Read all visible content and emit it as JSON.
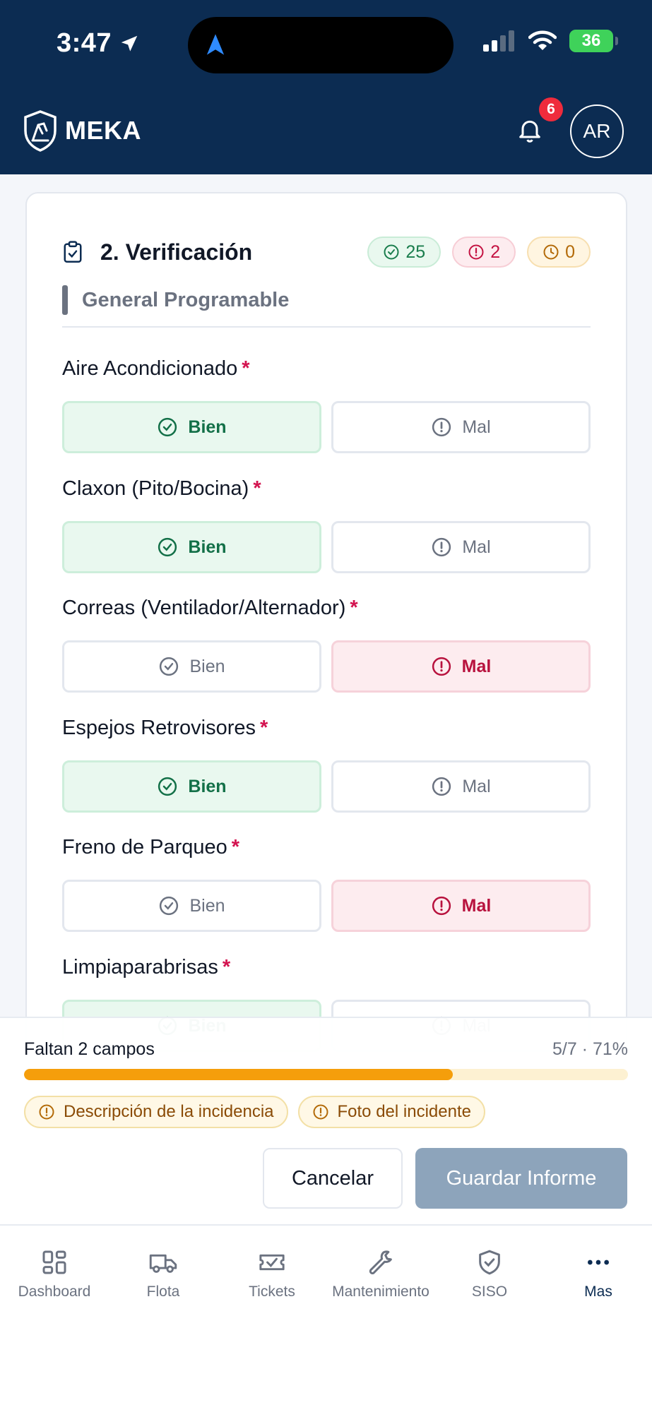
{
  "status_bar": {
    "time": "3:47",
    "battery": "36"
  },
  "header": {
    "brand": "MEKA",
    "notification_count": "6",
    "avatar_initials": "AR"
  },
  "card": {
    "title": "2. Verificación",
    "counters": {
      "ok": "25",
      "bad": "2",
      "pending": "0"
    },
    "section": "General Programable",
    "questions": [
      {
        "label": "Aire Acondicionado",
        "required": "*",
        "selected": "Bien"
      },
      {
        "label": "Claxon (Pito/Bocina)",
        "required": "*",
        "selected": "Bien"
      },
      {
        "label": "Correas (Ventilador/Alternador)",
        "required": "*",
        "selected": "Mal"
      },
      {
        "label": "Espejos Retrovisores",
        "required": "*",
        "selected": "Bien"
      },
      {
        "label": "Freno de Parqueo",
        "required": "*",
        "selected": "Mal"
      },
      {
        "label": "Limpiaparabrisas",
        "required": "*",
        "selected": "Bien"
      }
    ],
    "option_ok": "Bien",
    "option_bad": "Mal"
  },
  "footer": {
    "missing_text": "Faltan 2 campos",
    "progress_text": "5/7 · 71%",
    "progress_percent": 71,
    "missing_fields": [
      "Descripción de la incidencia",
      "Foto del incidente"
    ],
    "cancel_label": "Cancelar",
    "save_label": "Guardar Informe"
  },
  "tabs": [
    {
      "label": "Dashboard",
      "icon": "dashboard-icon"
    },
    {
      "label": "Flota",
      "icon": "truck-icon"
    },
    {
      "label": "Tickets",
      "icon": "ticket-icon"
    },
    {
      "label": "Mantenimiento",
      "icon": "wrench-icon"
    },
    {
      "label": "SISO",
      "icon": "shield-icon"
    },
    {
      "label": "Mas",
      "icon": "more-icon",
      "active": true
    }
  ],
  "colors": {
    "navy": "#0c2c52",
    "success": "#137048",
    "danger": "#b8123e",
    "warning": "#f59e0b",
    "save_disabled": "#8da4bb"
  }
}
